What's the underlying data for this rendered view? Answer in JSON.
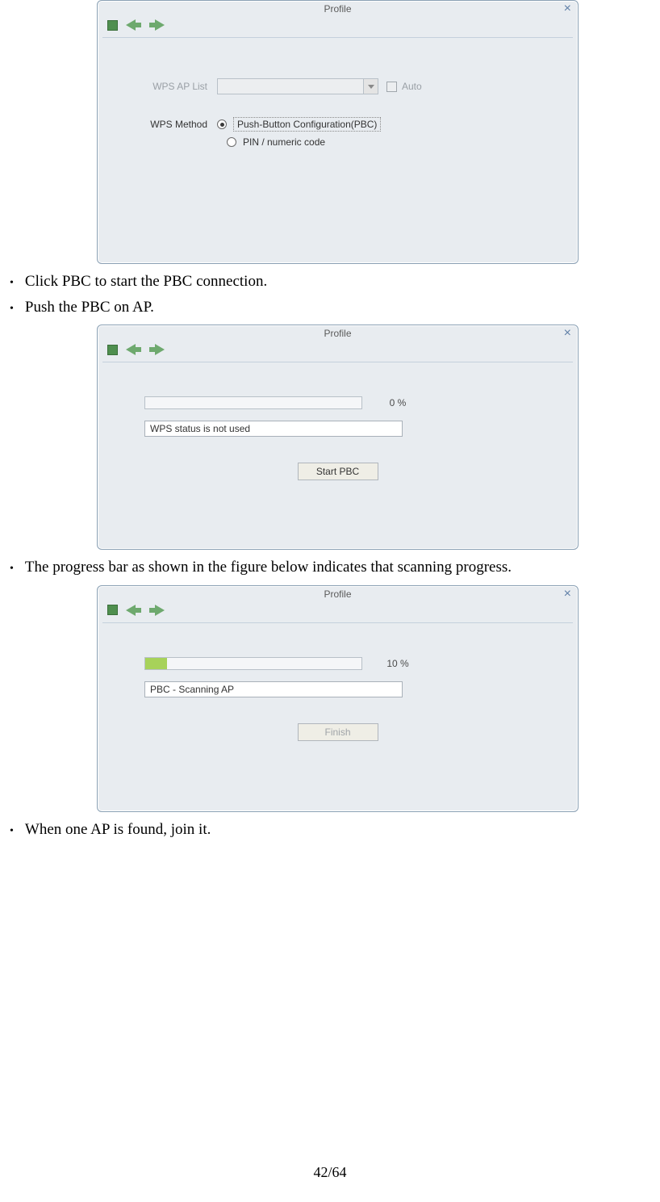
{
  "dialog1": {
    "title": "Profile",
    "wps_ap_list_label": "WPS AP List",
    "auto_label": "Auto",
    "wps_method_label": "WPS Method",
    "opt_pbc": "Push-Button Configuration(PBC)",
    "opt_pin": "PIN / numeric code"
  },
  "bullets1": [
    "Click PBC to start the PBC connection.",
    "Push the PBC on AP."
  ],
  "dialog2": {
    "title": "Profile",
    "progress_pct": "0 %",
    "progress_fill": 0,
    "status": "WPS status is not used",
    "button": "Start PBC"
  },
  "bullets2": [
    "The progress bar as shown in the figure below indicates that scanning progress."
  ],
  "dialog3": {
    "title": "Profile",
    "progress_pct": "10 %",
    "progress_fill": 10,
    "status": "PBC - Scanning AP",
    "button": "Finish"
  },
  "bullets3": [
    "When one AP is found, join it."
  ],
  "page_number": "42/64"
}
